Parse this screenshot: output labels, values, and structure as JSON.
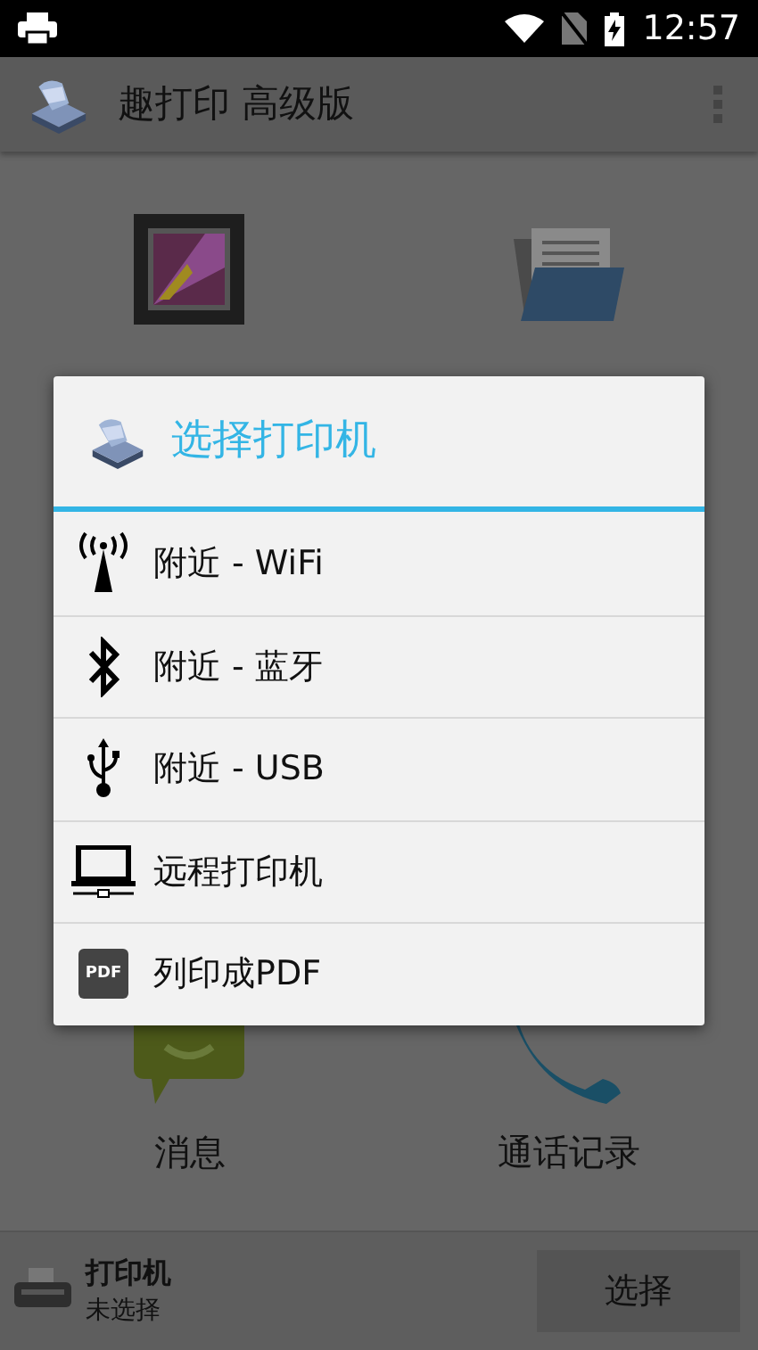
{
  "status_bar": {
    "time": "12:57"
  },
  "app_bar": {
    "title": "趣打印 高级版"
  },
  "tiles": [
    {
      "kind": "pictures"
    },
    {
      "kind": "documents"
    },
    {
      "label": "消息",
      "kind": "messages"
    },
    {
      "label": "通话记录",
      "kind": "calls"
    }
  ],
  "dialog": {
    "title": "选择打印机",
    "options": [
      {
        "label": "附近 - WiFi",
        "kind": "wifi"
      },
      {
        "label": "附近 - 蓝牙",
        "kind": "bluetooth"
      },
      {
        "label": "附近 - USB",
        "kind": "usb"
      },
      {
        "label": "远程打印机",
        "kind": "remote"
      },
      {
        "label": "列印成PDF",
        "kind": "pdf",
        "badge": "PDF"
      }
    ]
  },
  "bottom_bar": {
    "title": "打印机",
    "subtitle": "未选择",
    "button": "选择"
  }
}
